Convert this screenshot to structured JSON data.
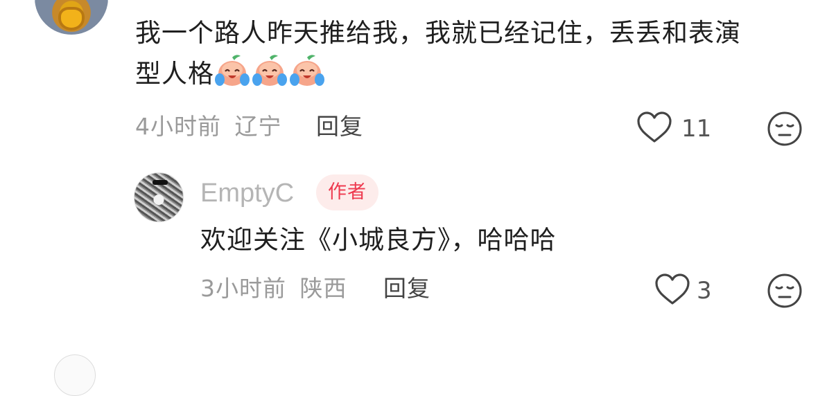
{
  "comment1": {
    "text": "我一个路人昨天推给我，我就已经记住，丢丢和表演",
    "text_line2": "型人格",
    "emoji_name": "crying-laughing-peach-emoji",
    "emoji_count": 3,
    "time": "4小时前",
    "location": "辽宁",
    "reply_label": "回复",
    "like_count": "11"
  },
  "reply1": {
    "username": "EmptyC",
    "badge": "作者",
    "text": "欢迎关注《小城良方》，哈哈哈",
    "time": "3小时前",
    "location": "陕西",
    "reply_label": "回复",
    "like_count": "3"
  },
  "colors": {
    "badge_bg": "#fdeceb",
    "badge_text": "#ee3a4f",
    "meta_text": "#9a9a9a",
    "body_text": "#1f1f1f"
  }
}
